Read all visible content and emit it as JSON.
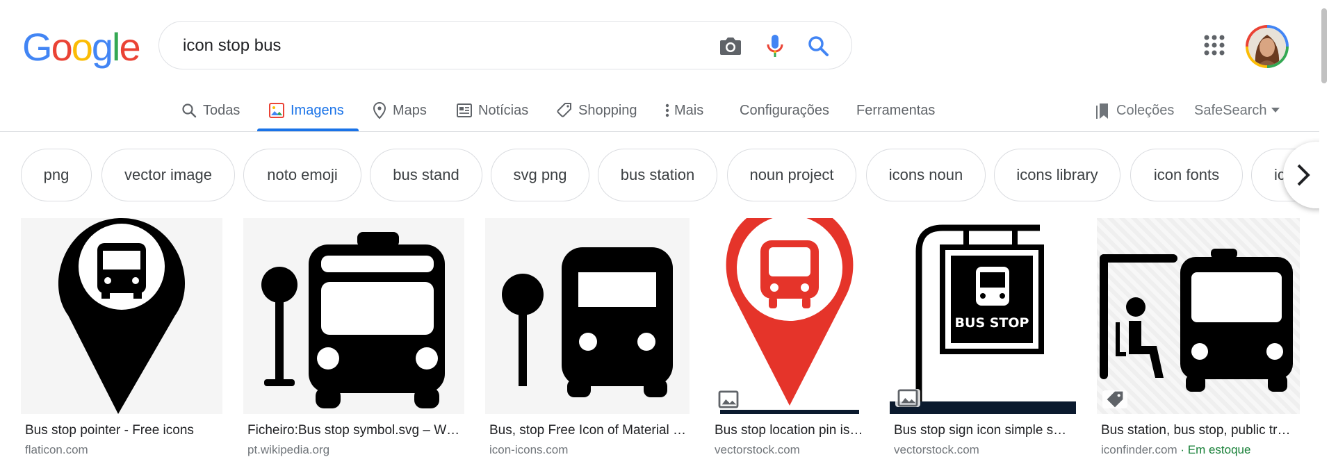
{
  "logo": [
    "G",
    "o",
    "o",
    "g",
    "l",
    "e"
  ],
  "search": {
    "query": "icon stop bus",
    "camera_icon": "camera-icon",
    "mic_icon": "mic-icon",
    "search_icon": "search-icon"
  },
  "header": {
    "apps_icon": "apps-grid-icon",
    "avatar": "profile-avatar"
  },
  "tabs": [
    {
      "label": "Todas",
      "icon": "search-icon",
      "active": false
    },
    {
      "label": "Imagens",
      "icon": "image-icon",
      "active": true
    },
    {
      "label": "Maps",
      "icon": "map-pin-icon",
      "active": false
    },
    {
      "label": "Notícias",
      "icon": "newspaper-icon",
      "active": false
    },
    {
      "label": "Shopping",
      "icon": "tag-icon",
      "active": false
    },
    {
      "label": "Mais",
      "icon": "more-vert-icon",
      "active": false
    }
  ],
  "tools": {
    "settings": "Configurações",
    "tools": "Ferramentas",
    "collections": "Coleções",
    "safesearch": "SafeSearch"
  },
  "chips": [
    "png",
    "vector image",
    "noto emoji",
    "bus stand",
    "svg png",
    "bus station",
    "noun project",
    "icons noun",
    "icons library",
    "icon fonts",
    "ic"
  ],
  "results": [
    {
      "title": "Bus stop pointer - Free icons",
      "source": "flaticon.com",
      "stock": ""
    },
    {
      "title": "Ficheiro:Bus stop symbol.svg – W…",
      "source": "pt.wikipedia.org",
      "stock": ""
    },
    {
      "title": "Bus, stop Free Icon of Material …",
      "source": "icon-icons.com",
      "stock": ""
    },
    {
      "title": "Bus stop location pin is…",
      "source": "vectorstock.com",
      "stock": ""
    },
    {
      "title": "Bus stop sign icon simple s…",
      "source": "vectorstock.com",
      "stock": "",
      "image_text": "BUS STOP"
    },
    {
      "title": "Bus station, bus stop, public tr…",
      "source": "iconfinder.com",
      "stock": " · Em estoque"
    }
  ],
  "colors": {
    "accent": "#1a73e8",
    "pin_red": "#e5342a",
    "stock_green": "#188038"
  }
}
